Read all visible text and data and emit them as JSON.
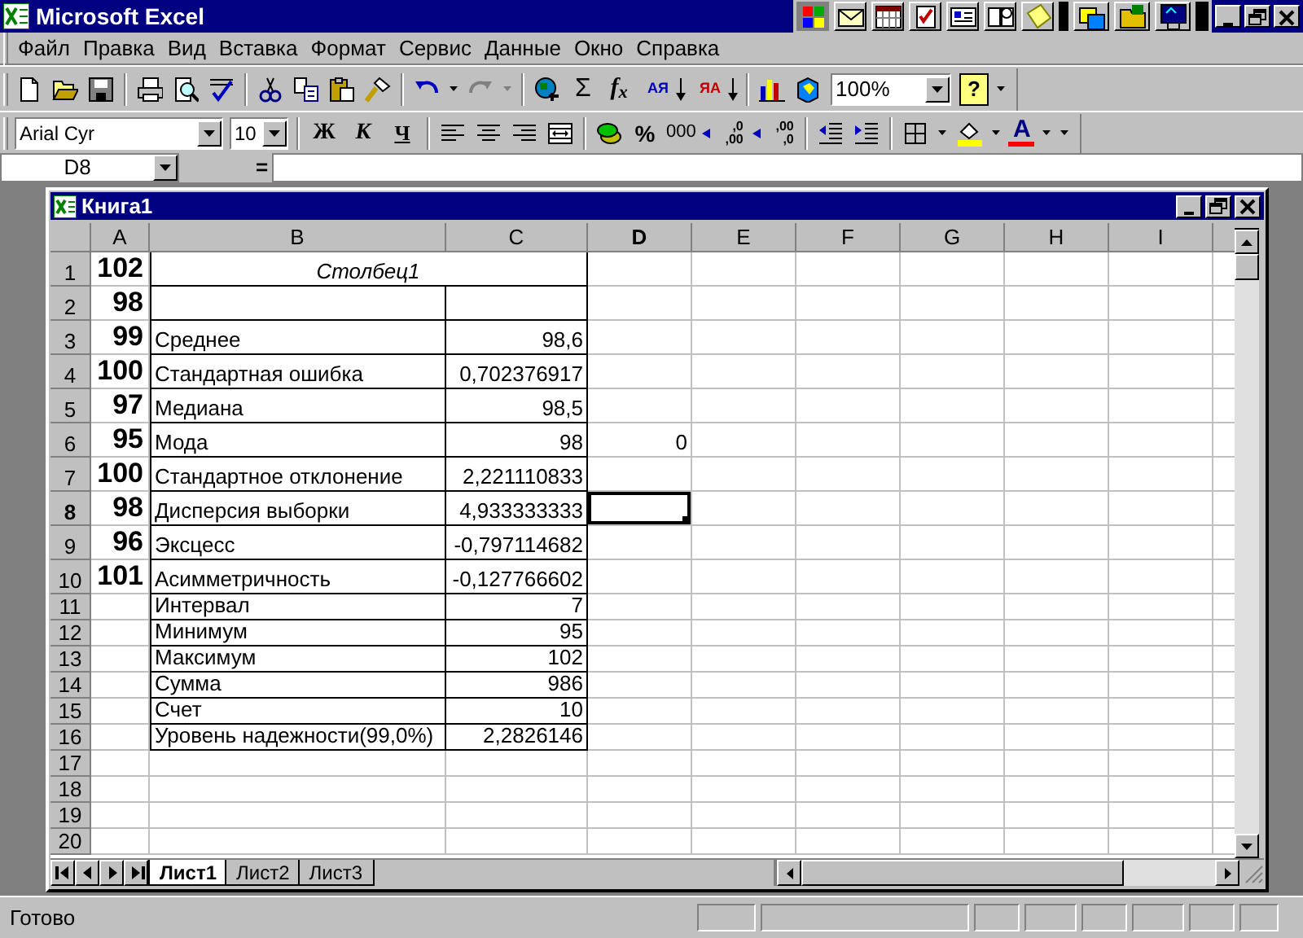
{
  "window": {
    "title": "Microsoft Excel"
  },
  "menu": [
    "Файл",
    "Правка",
    "Вид",
    "Вставка",
    "Формат",
    "Сервис",
    "Данные",
    "Окно",
    "Справка"
  ],
  "standard_toolbar": {
    "autosum": "Σ",
    "function": "f$_{x}$",
    "sort_ascending": "АЯ",
    "sort_descending": "ЯА",
    "zoom": "100%",
    "help": "?"
  },
  "formatting_toolbar": {
    "font": "Arial Cyr",
    "size": "10",
    "bold": "Ж",
    "italic": "К",
    "underline": "Ч",
    "percent": "%",
    "thousands": "000",
    "increase_decimal": ",0 ,00",
    "decrease_decimal": ",00 ,0",
    "font_color": "A"
  },
  "formula_bar": {
    "cell": "D8",
    "equals": "="
  },
  "workbook": {
    "title": "Книга1",
    "columns": [
      {
        "label": "A",
        "selected": false
      },
      {
        "label": "B",
        "selected": false
      },
      {
        "label": "C",
        "selected": false
      },
      {
        "label": "D",
        "selected": true
      },
      {
        "label": "E",
        "selected": false
      },
      {
        "label": "F",
        "selected": false
      },
      {
        "label": "G",
        "selected": false
      },
      {
        "label": "H",
        "selected": false
      },
      {
        "label": "I",
        "selected": false
      }
    ],
    "rows": [
      {
        "number": "1",
        "selected": false,
        "boxed": true,
        "a": "102",
        "title": "Столбец1"
      },
      {
        "number": "2",
        "selected": false,
        "boxed": true,
        "a": "98"
      },
      {
        "number": "3",
        "selected": false,
        "boxed": true,
        "a": "99",
        "b": "Среднее",
        "c": "98,6"
      },
      {
        "number": "4",
        "selected": false,
        "boxed": true,
        "a": "100",
        "b": "Стандартная ошибка",
        "c": "0,702376917"
      },
      {
        "number": "5",
        "selected": false,
        "boxed": true,
        "a": "97",
        "b": "Медиана",
        "c": "98,5"
      },
      {
        "number": "6",
        "selected": false,
        "boxed": true,
        "a": "95",
        "b": "Мода",
        "c": "98",
        "d": "0"
      },
      {
        "number": "7",
        "selected": false,
        "boxed": true,
        "a": "100",
        "b": "Стандартное отклонение",
        "c": "2,221110833"
      },
      {
        "number": "8",
        "selected": true,
        "boxed": true,
        "a": "98",
        "b": "Дисперсия выборки",
        "c": "4,933333333"
      },
      {
        "number": "9",
        "selected": false,
        "boxed": true,
        "a": "96",
        "b": "Эксцесс",
        "c": "-0,797114682"
      },
      {
        "number": "10",
        "selected": false,
        "boxed": true,
        "a": "101",
        "b": "Асимметричность",
        "c": "-0,127766602"
      },
      {
        "number": "11",
        "selected": false,
        "boxed": true,
        "b": "Интервал",
        "c": "7"
      },
      {
        "number": "12",
        "selected": false,
        "boxed": true,
        "b": "Минимум",
        "c": "95"
      },
      {
        "number": "13",
        "selected": false,
        "boxed": true,
        "b": "Максимум",
        "c": "102"
      },
      {
        "number": "14",
        "selected": false,
        "boxed": true,
        "b": "Сумма",
        "c": "986"
      },
      {
        "number": "15",
        "selected": false,
        "boxed": true,
        "b": "Счет",
        "c": "10"
      },
      {
        "number": "16",
        "selected": false,
        "boxed": true,
        "b": "Уровень надежности(99,0%)",
        "c": "2,2826146"
      },
      {
        "number": "17",
        "selected": false,
        "boxed": false
      },
      {
        "number": "18",
        "selected": false,
        "boxed": false
      },
      {
        "number": "19",
        "selected": false,
        "boxed": false
      },
      {
        "number": "20",
        "selected": false,
        "boxed": false
      }
    ],
    "sheets": [
      {
        "label": "Лист1",
        "selected": true
      },
      {
        "label": "Лист2",
        "selected": false
      },
      {
        "label": "Лист3",
        "selected": false
      }
    ]
  },
  "status_bar": {
    "text": "Готово"
  }
}
